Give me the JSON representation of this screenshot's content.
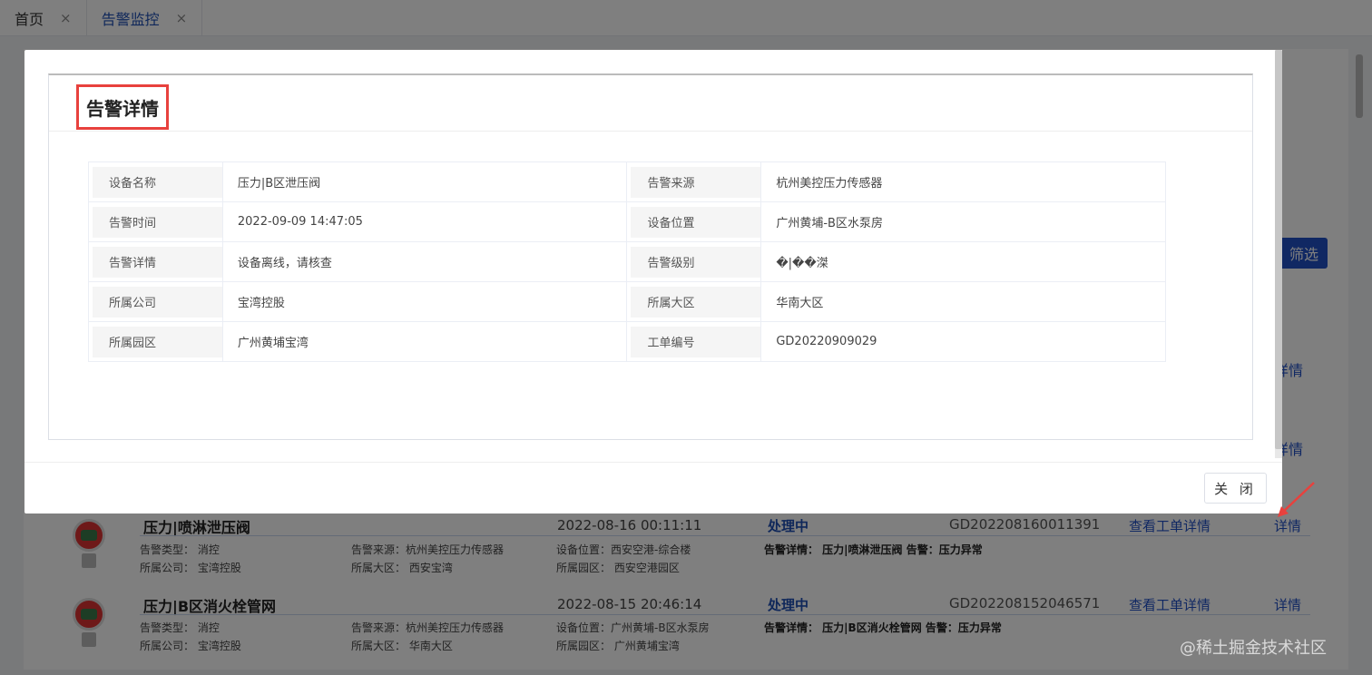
{
  "tabs": [
    {
      "label": "首页",
      "close": "×"
    },
    {
      "label": "告警监控",
      "close": "×"
    }
  ],
  "background": {
    "filter_label": "筛选",
    "partial_links": [
      "详情",
      "详情"
    ],
    "rows": [
      {
        "name": "压力|喷淋泄压阀",
        "time": "2022-08-16 00:11:11",
        "status": "处理中",
        "order": "GD202208160011391",
        "view_label": "查看工单详情",
        "detail_label": "详情",
        "type": "告警类型： 消控",
        "source": "告警来源：杭州美控压力传感器",
        "location": "设备位置：西安空港-综合楼",
        "detail_text": "告警详情： 压力|喷淋泄压阀 告警：压力异常",
        "company": "所属公司： 宝湾控股",
        "region": "所属大区： 西安宝湾",
        "park": "所属园区： 西安空港园区"
      },
      {
        "name": "压力|B区消火栓管网",
        "time": "2022-08-15 20:46:14",
        "status": "处理中",
        "order": "GD202208152046571",
        "view_label": "查看工单详情",
        "detail_label": "详情",
        "type": "告警类型： 消控",
        "source": "告警来源：杭州美控压力传感器",
        "location": "设备位置：广州黄埔-B区水泵房",
        "detail_text": "告警详情： 压力|B区消火栓管网 告警：压力异常",
        "company": "所属公司： 宝湾控股",
        "region": "所属大区： 华南大区",
        "park": "所属园区： 广州黄埔宝湾"
      }
    ]
  },
  "modal": {
    "title": "告警详情",
    "close_label": "关 闭",
    "fields": [
      [
        {
          "label": "设备名称",
          "value": "压力|B区泄压阀"
        },
        {
          "label": "告警来源",
          "value": "杭州美控压力传感器"
        }
      ],
      [
        {
          "label": "告警时间",
          "value": "2022-09-09 14:47:05"
        },
        {
          "label": "设备位置",
          "value": "广州黄埔-B区水泵房"
        }
      ],
      [
        {
          "label": "告警详情",
          "value": "设备离线，请核查"
        },
        {
          "label": "告警级别",
          "value": "�|��滐"
        }
      ],
      [
        {
          "label": "所属公司",
          "value": "宝湾控股"
        },
        {
          "label": "所属大区",
          "value": "华南大区"
        }
      ],
      [
        {
          "label": "所属园区",
          "value": "广州黄埔宝湾"
        },
        {
          "label": "工单编号",
          "value": "GD20220909029"
        }
      ]
    ]
  },
  "watermark": "@稀土掘金技术社区"
}
